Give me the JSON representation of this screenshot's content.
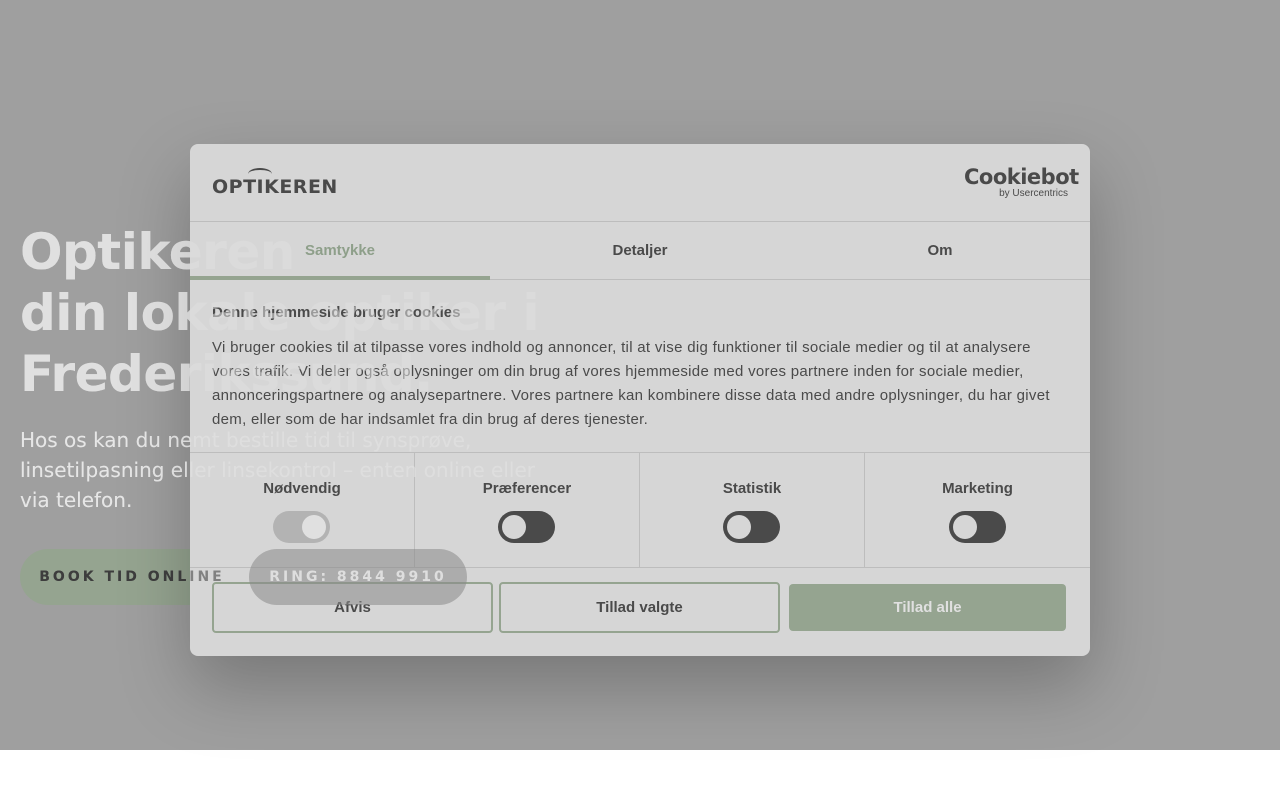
{
  "hero": {
    "title_lines": [
      "Optikeren",
      "din lokale optiker i",
      "Frederikssund."
    ],
    "subtitle": "Hos os kan du nemt bestille tid til synsprøve, linsetilpasning eller linsekontrol – enten online eller via telefon.",
    "book_button": "BOOK TID ONLINE",
    "ring_button": "RING: 8844 9910"
  },
  "dialog": {
    "logo_text": "OPTIKEREN",
    "cookiebot_brand": "Cookiebot",
    "cookiebot_by": "by Usercentrics",
    "tabs": [
      {
        "label": "Samtykke",
        "active": true
      },
      {
        "label": "Detaljer",
        "active": false
      },
      {
        "label": "Om",
        "active": false
      }
    ],
    "heading": "Denne hjemmeside bruger cookies",
    "body": "Vi bruger cookies til at tilpasse vores indhold og annoncer, til at vise dig funktioner til sociale medier og til at analysere vores trafik. Vi deler også oplysninger om din brug af vores hjemmeside med vores partnere inden for sociale medier, annonceringspartnere og analysepartnere. Vores partnere kan kombinere disse data med andre oplysninger, du har givet dem, eller som de har indsamlet fra din brug af deres tjenester.",
    "categories": [
      {
        "label": "Nødvendig",
        "enabled": true,
        "disabled": true
      },
      {
        "label": "Præferencer",
        "enabled": false,
        "disabled": false
      },
      {
        "label": "Statistik",
        "enabled": false,
        "disabled": false
      },
      {
        "label": "Marketing",
        "enabled": false,
        "disabled": false
      }
    ],
    "buttons": {
      "decline": "Afvis",
      "allow_selected": "Tillad valgte",
      "allow_all": "Tillad alle"
    }
  },
  "colors": {
    "accent": "#95a490",
    "dialog_bg": "#d6d6d6",
    "overlay": "#9f9f9f",
    "text": "#4a4a4a"
  }
}
